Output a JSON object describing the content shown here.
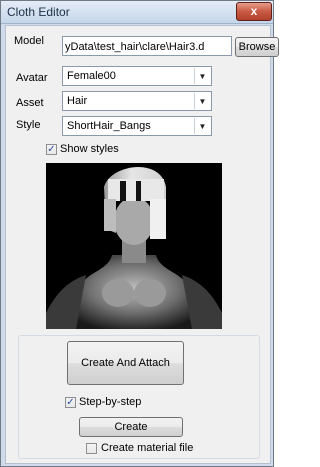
{
  "window": {
    "title": "Cloth Editor",
    "close_label": "x"
  },
  "model": {
    "label": "Model",
    "value": "yData\\test_hair\\clare\\Hair3.d",
    "browse_label": "Browse"
  },
  "avatar": {
    "label": "Avatar",
    "value": "Female00"
  },
  "asset": {
    "label": "Asset",
    "value": "Hair"
  },
  "style": {
    "label": "Style",
    "value": "ShortHair_Bangs"
  },
  "show_styles": {
    "label": "Show styles",
    "checked": true
  },
  "actions": {
    "create_and_attach_label": "Create And Attach",
    "step_by_step_label": "Step-by-step",
    "step_by_step_checked": true,
    "create_label": "Create",
    "create_material_label": "Create material file",
    "create_material_checked": false
  },
  "colors": {
    "title_bar": "#c5d6ea",
    "close_button": "#c85a44",
    "preview_bg": "#000000"
  }
}
